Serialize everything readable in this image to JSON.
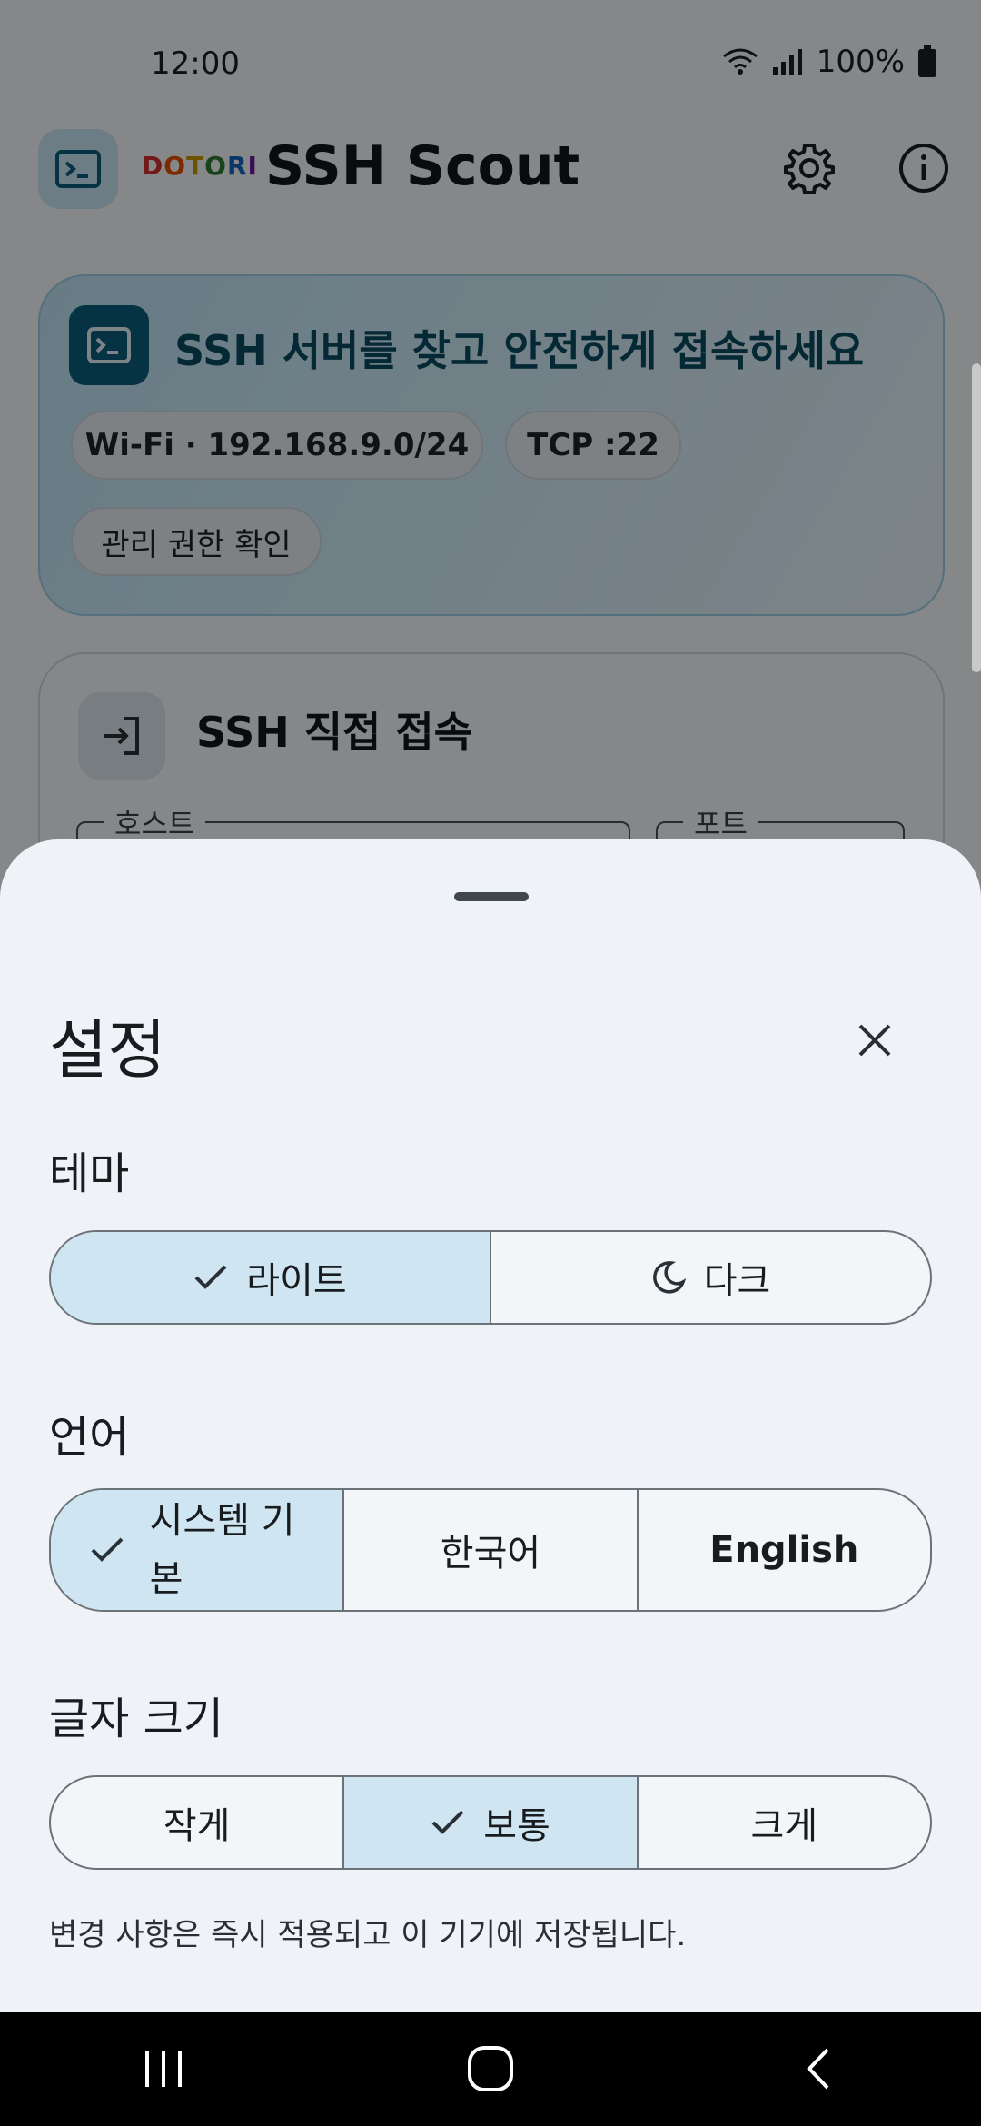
{
  "status_bar": {
    "time": "12:00",
    "battery": "100%"
  },
  "app": {
    "brand_letters": [
      {
        "ch": "D",
        "color": "#d32f2f"
      },
      {
        "ch": "O",
        "color": "#e65100"
      },
      {
        "ch": "T",
        "color": "#c79a00"
      },
      {
        "ch": "O",
        "color": "#2e7d32"
      },
      {
        "ch": "R",
        "color": "#1565c0"
      },
      {
        "ch": "I",
        "color": "#6a1b9a"
      }
    ],
    "title": "SSH Scout",
    "hero_title": "SSH 서버를 찾고 안전하게 접속하세요",
    "chips": [
      "Wi-Fi · 192.168.9.0/24",
      "TCP :22",
      "관리 권한 확인"
    ],
    "direct_title": "SSH 직접 접속",
    "host_label": "호스트",
    "port_label": "포트"
  },
  "settings": {
    "title": "설정",
    "theme": {
      "label": "테마",
      "options": [
        "라이트",
        "다크"
      ],
      "selected": "라이트"
    },
    "language": {
      "label": "언어",
      "options": [
        "시스템 기본",
        "한국어",
        "English"
      ],
      "selected": "시스템 기본"
    },
    "font_size": {
      "label": "글자 크기",
      "options": [
        "작게",
        "보통",
        "크게"
      ],
      "selected": "보통"
    },
    "note": "변경 사항은 즉시 적용되고 이 기기에 저장됩니다."
  },
  "colors": {
    "accent": "#0a5f7d",
    "selected_segment": "#cfe6f2"
  }
}
